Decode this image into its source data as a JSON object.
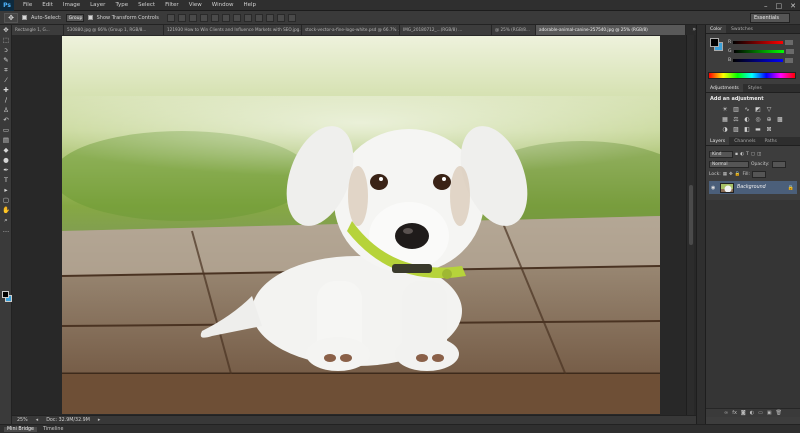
{
  "app": {
    "logo": "Ps"
  },
  "menu": [
    "File",
    "Edit",
    "Image",
    "Layer",
    "Type",
    "Select",
    "Filter",
    "View",
    "Window",
    "Help"
  ],
  "window_controls": {
    "minimize": "–",
    "maximize": "□",
    "close": "✕"
  },
  "options": {
    "tool_icon": "move-tool",
    "auto_select_label": "Auto-Select:",
    "auto_select_value": "Group",
    "transform_label": "Show Transform Controls",
    "workspace": "Essentials"
  },
  "tabs": [
    "Rectangle 1, G...",
    "530880.jpg @ 66% (Group 1, RGB/8...",
    "121930 How to Win Clients and Influence Markets with SEO.jpg...",
    "stock-vector-a-fine-logo-white.psd @ 66.7% ...",
    "IMG_20180712_...(RGB/8) ...",
    "@ 25% (RGB/8...",
    "adorable-animal-canine-257540.jpg @ 25% (RGB/8)"
  ],
  "status": {
    "zoom": "25%",
    "doc": "Doc: 32.9M/32.9M"
  },
  "bottom_tabs": [
    "Mini Bridge",
    "Timeline"
  ],
  "color_panel": {
    "tabs": [
      "Color",
      "Swatches"
    ],
    "rows": [
      "R",
      "G",
      "B"
    ],
    "fg": "#000000",
    "bg": "#3aa0d9"
  },
  "adjustments": {
    "tabs": [
      "Adjustments",
      "Styles"
    ],
    "title": "Add an adjustment"
  },
  "layers": {
    "tabs": [
      "Layers",
      "Channels",
      "Paths"
    ],
    "kind": "Kind",
    "blend": "Normal",
    "opacity_label": "Opacity:",
    "lock_label": "Lock:",
    "fill_label": "Fill:",
    "layer_name": "Background"
  },
  "colors": {
    "accent_layer": "#4b5f7a",
    "ui_dark": "#282828"
  }
}
